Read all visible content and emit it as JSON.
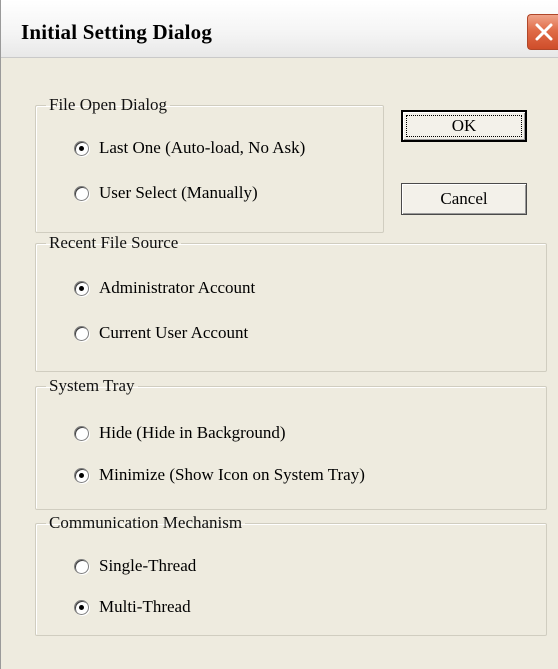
{
  "window": {
    "title": "Initial Setting Dialog"
  },
  "groups": {
    "file_open": {
      "legend": "File Open Dialog",
      "options": [
        {
          "label": "Last One (Auto-load, No Ask)",
          "checked": true
        },
        {
          "label": "User Select (Manually)",
          "checked": false
        }
      ]
    },
    "recent_source": {
      "legend": "Recent File Source",
      "options": [
        {
          "label": "Administrator Account",
          "checked": true
        },
        {
          "label": "Current User Account",
          "checked": false
        }
      ]
    },
    "system_tray": {
      "legend": "System Tray",
      "options": [
        {
          "label": "Hide (Hide in Background)",
          "checked": false
        },
        {
          "label": "Minimize (Show Icon on System Tray)",
          "checked": true
        }
      ]
    },
    "comm": {
      "legend": "Communication Mechanism",
      "options": [
        {
          "label": "Single-Thread",
          "checked": false
        },
        {
          "label": "Multi-Thread",
          "checked": true
        }
      ]
    }
  },
  "buttons": {
    "ok": "OK",
    "cancel": "Cancel"
  },
  "colors": {
    "dialog_bg": "#eeebdf",
    "close_button": "#e06c48",
    "group_border": "#d0cdc0"
  },
  "icons": {
    "close": "close-icon",
    "radio": "radio-button"
  }
}
